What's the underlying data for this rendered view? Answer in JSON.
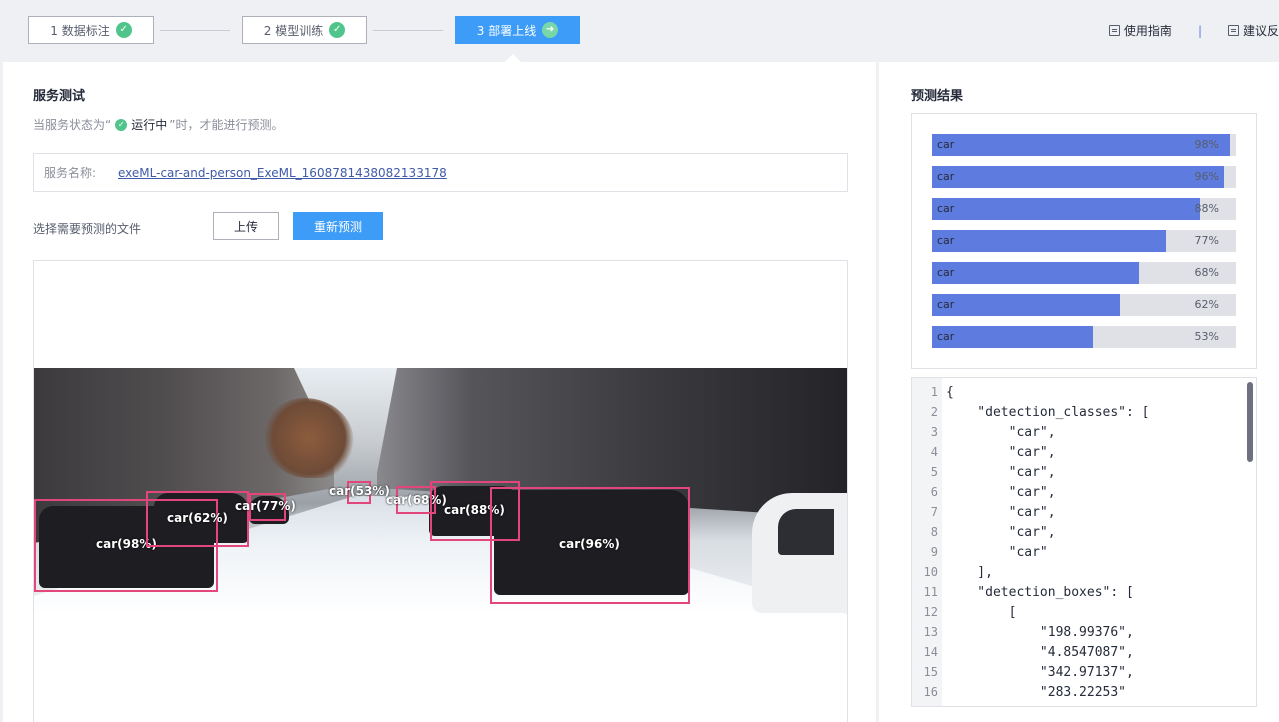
{
  "steps": [
    {
      "label": "1 数据标注",
      "state": "done"
    },
    {
      "label": "2 模型训练",
      "state": "done"
    },
    {
      "label": "3 部署上线",
      "state": "active"
    }
  ],
  "top_links": {
    "guide": "使用指南",
    "separator": "|",
    "feedback": "建议反"
  },
  "service_test": {
    "title": "服务测试",
    "hint_prefix": "当服务状态为“",
    "hint_status": "运行中",
    "hint_suffix": "”时，才能进行预测。",
    "service_name_label": "服务名称:",
    "service_name_value": "exeML-car-and-person_ExeML_1608781438082133178",
    "select_file_label": "选择需要预测的文件",
    "upload_button": "上传",
    "repredict_button": "重新预测"
  },
  "detections": [
    {
      "label": "car(98%)"
    },
    {
      "label": "car(62%)"
    },
    {
      "label": "car(77%)"
    },
    {
      "label": "car(53%)"
    },
    {
      "label": "car(68%)"
    },
    {
      "label": "car(88%)"
    },
    {
      "label": "car(96%)"
    }
  ],
  "results": {
    "title": "预测结果",
    "bars": [
      {
        "class": "car",
        "percent_label": "98%",
        "value": 0.98
      },
      {
        "class": "car",
        "percent_label": "96%",
        "value": 0.96
      },
      {
        "class": "car",
        "percent_label": "88%",
        "value": 0.88
      },
      {
        "class": "car",
        "percent_label": "77%",
        "value": 0.77
      },
      {
        "class": "car",
        "percent_label": "68%",
        "value": 0.68
      },
      {
        "class": "car",
        "percent_label": "62%",
        "value": 0.62
      },
      {
        "class": "car",
        "percent_label": "53%",
        "value": 0.53
      }
    ]
  },
  "code_lines": [
    {
      "n": "1",
      "text": "{"
    },
    {
      "n": "2",
      "text": "    \"detection_classes\": ["
    },
    {
      "n": "3",
      "text": "        \"car\","
    },
    {
      "n": "4",
      "text": "        \"car\","
    },
    {
      "n": "5",
      "text": "        \"car\","
    },
    {
      "n": "6",
      "text": "        \"car\","
    },
    {
      "n": "7",
      "text": "        \"car\","
    },
    {
      "n": "8",
      "text": "        \"car\","
    },
    {
      "n": "9",
      "text": "        \"car\""
    },
    {
      "n": "10",
      "text": "    ],"
    },
    {
      "n": "11",
      "text": "    \"detection_boxes\": ["
    },
    {
      "n": "12",
      "text": "        ["
    },
    {
      "n": "13",
      "text": "            \"198.99376\","
    },
    {
      "n": "14",
      "text": "            \"4.8547087\","
    },
    {
      "n": "15",
      "text": "            \"342.97137\","
    },
    {
      "n": "16",
      "text": "            \"283.22253\""
    }
  ],
  "colors": {
    "accent": "#3c9cf7",
    "bar_fill": "#5e7ce0",
    "bbox": "#e2467a",
    "success": "#50c58b"
  }
}
